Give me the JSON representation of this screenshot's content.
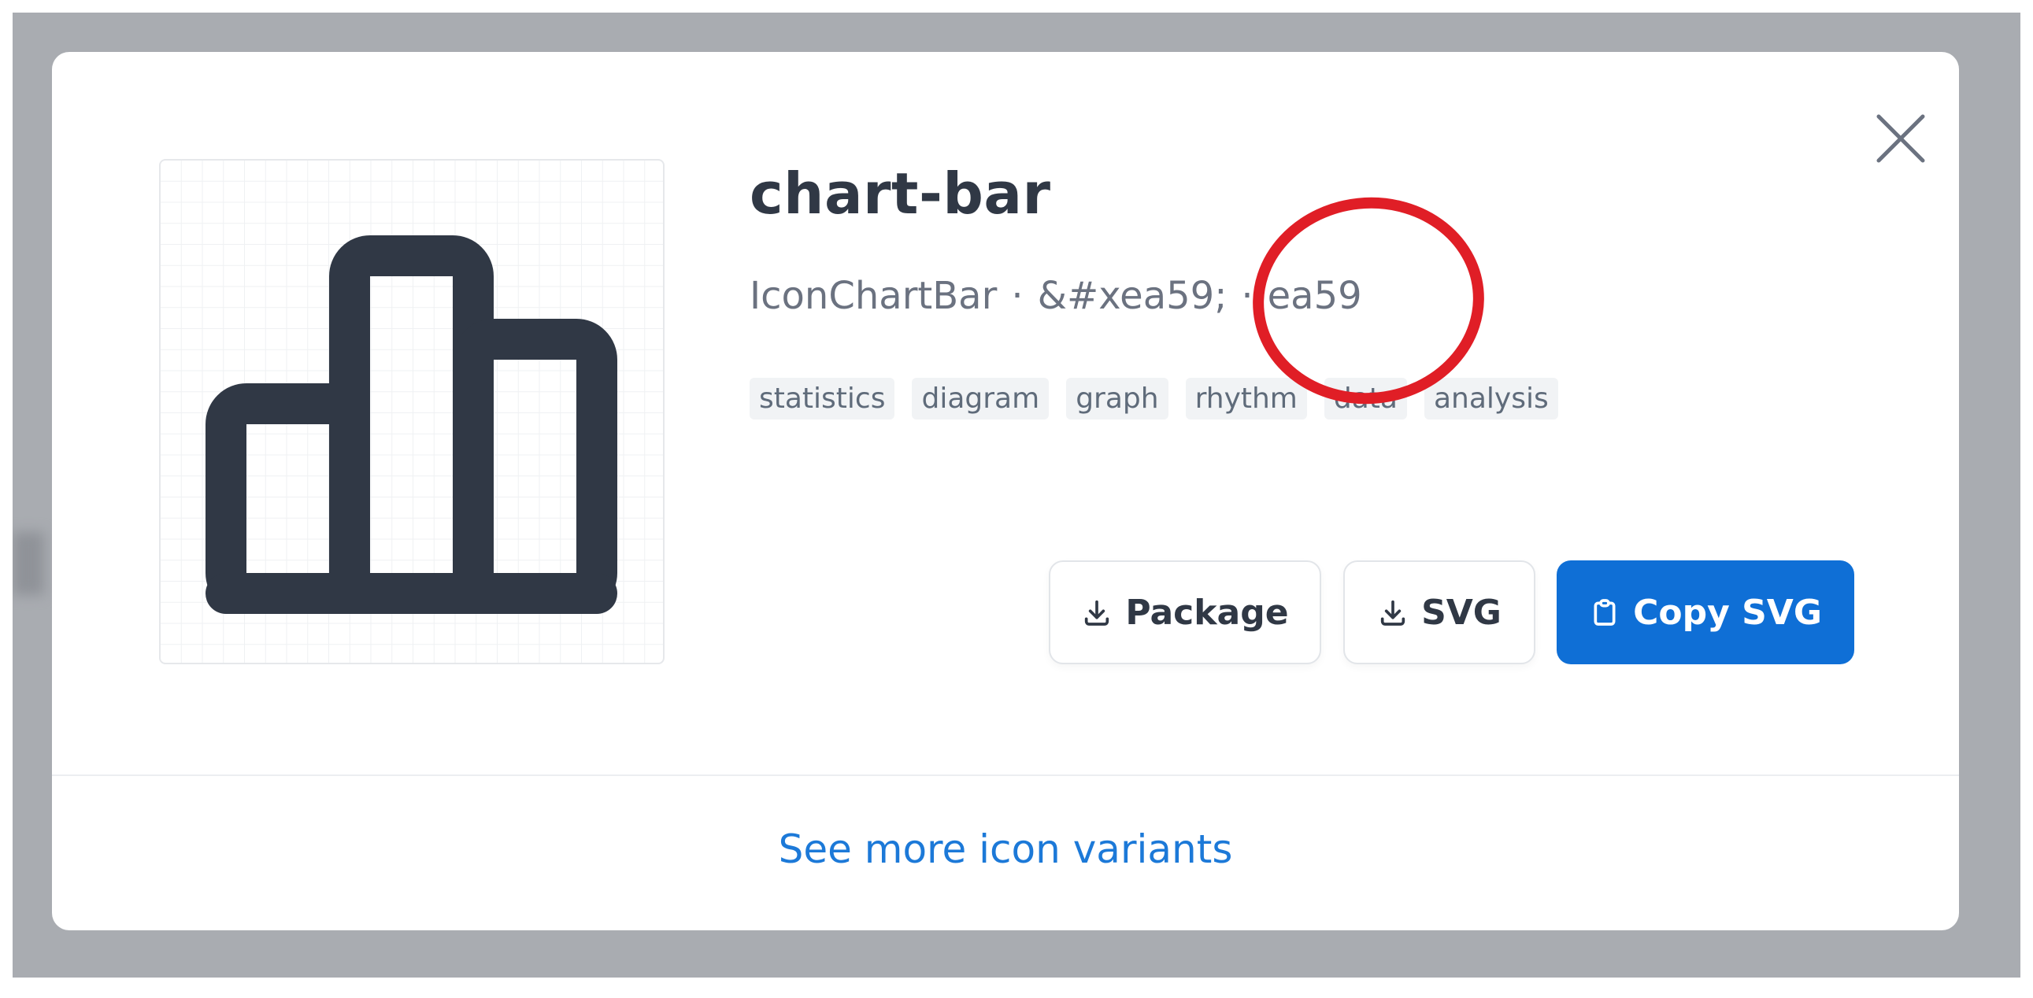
{
  "icon": {
    "name": "chart-bar",
    "component": "IconChartBar",
    "html_entity": "&#xea59;",
    "unicode": "ea59",
    "separator": "·",
    "tags": [
      "statistics",
      "diagram",
      "graph",
      "rhythm",
      "data",
      "analysis"
    ],
    "stroke_color": "#303845"
  },
  "actions": {
    "package_label": "Package",
    "svg_label": "SVG",
    "copy_svg_label": "Copy SVG"
  },
  "footer": {
    "more_variants_label": "See more icon variants"
  },
  "colors": {
    "primary": "#0f6fd6",
    "link": "#1c79d8",
    "annotation": "#e01e26",
    "backdrop": "#a9acb1"
  }
}
